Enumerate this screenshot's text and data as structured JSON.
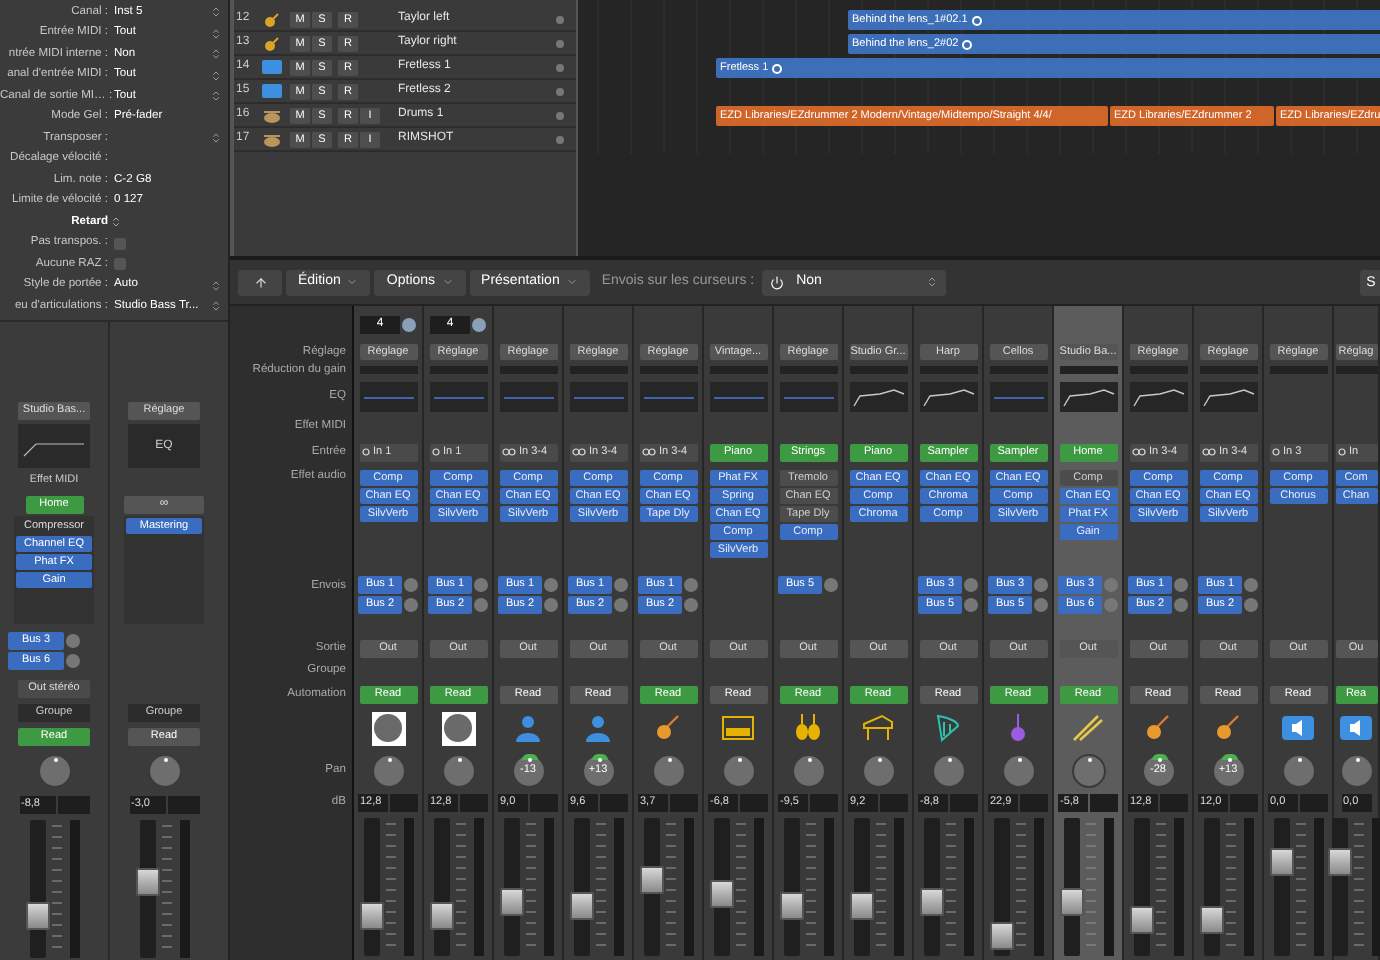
{
  "inspector": {
    "params": [
      {
        "label": "Canal :",
        "value": "Inst 5",
        "kind": "select"
      },
      {
        "label": "Entrée MIDI :",
        "value": "Tout",
        "kind": "select"
      },
      {
        "label": "ntrée MIDI interne :",
        "value": "Non",
        "kind": "select"
      },
      {
        "label": "anal d'entrée MIDI :",
        "value": "Tout",
        "kind": "select"
      },
      {
        "label": "Canal de sortie MI… :",
        "value": "Tout",
        "kind": "select"
      },
      {
        "label": "Mode Gel :",
        "value": "Pré-fader",
        "kind": "plain"
      },
      {
        "label": "Transposer :",
        "kind": "select"
      },
      {
        "label": "Décalage vélocité :",
        "kind": "plain"
      },
      {
        "label": "Lim. note :",
        "value": "C-2  G8",
        "kind": "plain"
      },
      {
        "label": "Limite de vélocité :",
        "value": "0  127",
        "kind": "plain"
      },
      {
        "label": "Retard",
        "kind": "stepper"
      },
      {
        "label": "Pas transpos. :",
        "checked": false,
        "kind": "checkbox"
      },
      {
        "label": "Aucune RAZ :",
        "checked": false,
        "kind": "checkbox"
      },
      {
        "label": "Style de portée :",
        "value": "Auto",
        "kind": "select"
      },
      {
        "label": "eu d'articulations :",
        "value": "Studio Bass Tr...",
        "kind": "select"
      }
    ]
  },
  "left_strips": [
    {
      "setting": "Studio Bas...",
      "midi_label": "Effet MIDI",
      "input": {
        "text": "Home",
        "kind": "instrument"
      },
      "inserts": [
        {
          "label": "Compressor",
          "active": false
        },
        {
          "label": "Channel EQ",
          "active": true
        },
        {
          "label": "Phat FX",
          "active": true
        },
        {
          "label": "Gain",
          "active": true
        }
      ],
      "sends": [
        {
          "label": "Bus 3"
        },
        {
          "label": "Bus 6"
        }
      ],
      "output": "Out stéréo",
      "group": "Groupe",
      "automation": {
        "label": "Read",
        "active": true
      },
      "db": "-8,8",
      "level": 0.25
    },
    {
      "setting": "Réglage",
      "eq_text": "EQ",
      "input": {
        "text": "∞",
        "kind": "link"
      },
      "inserts": [
        {
          "label": "Mastering",
          "active": true
        }
      ],
      "group": "Groupe",
      "automation": {
        "label": "Read",
        "active": false
      },
      "db": "-3,0",
      "level": 0.55
    }
  ],
  "tracks": [
    {
      "number": "12",
      "kind": "guitar",
      "buttons": [
        "M",
        "S",
        "R"
      ],
      "name": "Taylor left",
      "regions": [
        {
          "label": "Behind the lens_1#02.1",
          "kind": "audio",
          "looped": true
        }
      ]
    },
    {
      "number": "13",
      "kind": "guitar",
      "buttons": [
        "M",
        "S",
        "R"
      ],
      "name": "Taylor right",
      "regions": [
        {
          "label": "Behind the lens_2#02",
          "kind": "audio",
          "looped": true
        }
      ]
    },
    {
      "number": "14",
      "kind": "software",
      "buttons": [
        "M",
        "S",
        "R"
      ],
      "name": "Fretless 1",
      "regions": [
        {
          "label": "Fretless 1",
          "kind": "audio",
          "looped": true
        }
      ]
    },
    {
      "number": "15",
      "kind": "software",
      "buttons": [
        "M",
        "S",
        "R"
      ],
      "name": "Fretless 2"
    },
    {
      "number": "16",
      "kind": "drums",
      "buttons": [
        "M",
        "S",
        "R",
        "I"
      ],
      "name": "Drums 1",
      "regions": [
        {
          "label": "EZD Libraries/EZdrummer 2 Modern/Vintage/Midtempo/Straight 4/4/",
          "kind": "drummer",
          "looped": false
        },
        {
          "label": "EZD Libraries/EZdrummer 2",
          "kind": "drummer",
          "looped": false
        },
        {
          "label": "EZD Libraries/EZdru",
          "kind": "drummer",
          "looped": false
        }
      ]
    },
    {
      "number": "17",
      "kind": "drums",
      "buttons": [
        "M",
        "S",
        "R",
        "I"
      ],
      "name": "RIMSHOT"
    }
  ],
  "mixer": {
    "toolbar": {
      "menus": [
        "Édition",
        "Options",
        "Présentation"
      ],
      "sends_label": "Envois sur les curseurs :",
      "sends_value": "Non",
      "right_button": "S"
    },
    "row_labels": [
      "Réglage",
      "Réduction du gain",
      "EQ",
      "Effet MIDI",
      "Entrée",
      "Effet audio",
      "Envois",
      "Sortie",
      "Groupe",
      "Automation",
      "Pan",
      "dB"
    ],
    "strips": [
      {
        "kind": "avatar",
        "field": "4",
        "setting": "Réglage",
        "eq": {
          "kind": "flat"
        },
        "input": {
          "text": "In 1",
          "kind": "mono"
        },
        "inserts": [
          {
            "label": "Comp",
            "active": true
          },
          {
            "label": "Chan EQ",
            "active": true
          },
          {
            "label": "SilvVerb",
            "active": true
          }
        ],
        "sends": [
          {
            "label": "Bus 1"
          },
          {
            "label": "Bus 2"
          }
        ],
        "output": "Out",
        "automation": {
          "label": "Read",
          "active": true
        },
        "db": "12,8",
        "level": 0.22,
        "selected": false
      },
      {
        "kind": "avatar",
        "field": "4",
        "setting": "Réglage",
        "eq": {
          "kind": "flat"
        },
        "input": {
          "text": "In 1",
          "kind": "mono"
        },
        "inserts": [
          {
            "label": "Comp",
            "active": true
          },
          {
            "label": "Chan EQ",
            "active": true
          },
          {
            "label": "SilvVerb",
            "active": true
          }
        ],
        "sends": [
          {
            "label": "Bus 1"
          },
          {
            "label": "Bus 2"
          }
        ],
        "output": "Out",
        "automation": {
          "label": "Read",
          "active": true
        },
        "db": "12,8",
        "level": 0.22,
        "selected": false
      },
      {
        "kind": "person",
        "setting": "Réglage",
        "eq": {
          "kind": "flat"
        },
        "input": {
          "text": "In 3-4",
          "kind": "stereo"
        },
        "inserts": [
          {
            "label": "Comp",
            "active": true
          },
          {
            "label": "Chan EQ",
            "active": true
          },
          {
            "label": "SilvVerb",
            "active": true
          }
        ],
        "sends": [
          {
            "label": "Bus 1"
          },
          {
            "label": "Bus 2"
          }
        ],
        "output": "Out",
        "automation": {
          "label": "Read",
          "active": false
        },
        "pan": "-13",
        "db": "9,0",
        "level": 0.35,
        "selected": false
      },
      {
        "kind": "person",
        "setting": "Réglage",
        "eq": {
          "kind": "flat"
        },
        "input": {
          "text": "In 3-4",
          "kind": "stereo"
        },
        "inserts": [
          {
            "label": "Comp",
            "active": true
          },
          {
            "label": "Chan EQ",
            "active": true
          },
          {
            "label": "SilvVerb",
            "active": true
          }
        ],
        "sends": [
          {
            "label": "Bus 1"
          },
          {
            "label": "Bus 2"
          }
        ],
        "output": "Out",
        "automation": {
          "label": "Read",
          "active": false
        },
        "pan": "+13",
        "db": "9,6",
        "level": 0.32,
        "selected": false
      },
      {
        "kind": "guitar",
        "setting": "Réglage",
        "eq": {
          "kind": "flat"
        },
        "input": {
          "text": "In 3-4",
          "kind": "stereo"
        },
        "inserts": [
          {
            "label": "Comp",
            "active": true
          },
          {
            "label": "Chan EQ",
            "active": true
          },
          {
            "label": "Tape Dly",
            "active": true
          }
        ],
        "sends": [
          {
            "label": "Bus 1"
          },
          {
            "label": "Bus 2"
          }
        ],
        "output": "Out",
        "automation": {
          "label": "Read",
          "active": true
        },
        "db": "3,7",
        "level": 0.55,
        "selected": false
      },
      {
        "kind": "keyboard",
        "setting": "Vintage...",
        "eq": {
          "kind": "flat"
        },
        "input": {
          "text": "Piano",
          "kind": "instrument"
        },
        "inserts": [
          {
            "label": "Phat FX",
            "active": true
          },
          {
            "label": "Spring",
            "active": true
          },
          {
            "label": "Chan EQ",
            "active": true
          },
          {
            "label": "Comp",
            "active": true
          },
          {
            "label": "SilvVerb",
            "active": true
          }
        ],
        "output": "Out",
        "automation": {
          "label": "Read",
          "active": false
        },
        "db": "-6,8",
        "level": 0.42,
        "selected": false
      },
      {
        "kind": "violins",
        "setting": "Réglage",
        "eq": {
          "kind": "flat"
        },
        "input": {
          "text": "Strings",
          "kind": "instrument"
        },
        "inserts": [
          {
            "label": "Tremolo",
            "active": false
          },
          {
            "label": "Chan EQ",
            "active": false
          },
          {
            "label": "Tape Dly",
            "active": false
          },
          {
            "label": "Comp",
            "active": true
          }
        ],
        "sends": [
          {
            "label": "Bus 5"
          }
        ],
        "output": "Out",
        "automation": {
          "label": "Read",
          "active": true
        },
        "db": "-9,5",
        "level": 0.32,
        "selected": false
      },
      {
        "kind": "piano",
        "setting": "Studio Gr...",
        "eq": {
          "kind": "curve"
        },
        "input": {
          "text": "Piano",
          "kind": "instrument"
        },
        "inserts": [
          {
            "label": "Chan EQ",
            "active": true
          },
          {
            "label": "Comp",
            "active": true
          },
          {
            "label": "Chroma",
            "active": true
          }
        ],
        "output": "Out",
        "automation": {
          "label": "Read",
          "active": true
        },
        "db": "9,2",
        "level": 0.32,
        "selected": false
      },
      {
        "kind": "harp",
        "setting": "Harp",
        "eq": {
          "kind": "curve"
        },
        "input": {
          "text": "Sampler",
          "kind": "instrument"
        },
        "inserts": [
          {
            "label": "Chan EQ",
            "active": true
          },
          {
            "label": "Chroma",
            "active": true
          },
          {
            "label": "Comp",
            "active": true
          }
        ],
        "sends": [
          {
            "label": "Bus 3"
          },
          {
            "label": "Bus 5"
          }
        ],
        "output": "Out",
        "automation": {
          "label": "Read",
          "active": false
        },
        "db": "-8,8",
        "level": 0.35,
        "selected": false
      },
      {
        "kind": "violin",
        "setting": "Cellos",
        "eq": {
          "kind": "flat"
        },
        "input": {
          "text": "Sampler",
          "kind": "instrument"
        },
        "inserts": [
          {
            "label": "Chan EQ",
            "active": true
          },
          {
            "label": "Comp",
            "active": true
          },
          {
            "label": "SilvVerb",
            "active": true
          }
        ],
        "sends": [
          {
            "label": "Bus 3"
          },
          {
            "label": "Bus 5"
          }
        ],
        "output": "Out",
        "automation": {
          "label": "Read",
          "active": true
        },
        "db": "22,9",
        "level": 0.05,
        "selected": false
      },
      {
        "kind": "drumsticks",
        "setting": "Studio Ba...",
        "eq": {
          "kind": "curve"
        },
        "input": {
          "text": "Home",
          "kind": "instrument"
        },
        "inserts": [
          {
            "label": "Comp",
            "active": false
          },
          {
            "label": "Chan EQ",
            "active": true
          },
          {
            "label": "Phat FX",
            "active": true
          },
          {
            "label": "Gain",
            "active": true
          }
        ],
        "sends": [
          {
            "label": "Bus 3"
          },
          {
            "label": "Bus 6"
          }
        ],
        "output": "Out",
        "automation": {
          "label": "Read",
          "active": true
        },
        "db": "-5,8",
        "level": 0.35,
        "selected": true
      },
      {
        "kind": "guitar",
        "setting": "Réglage",
        "eq": {
          "kind": "curve"
        },
        "input": {
          "text": "In 3-4",
          "kind": "stereo"
        },
        "inserts": [
          {
            "label": "Comp",
            "active": true
          },
          {
            "label": "Chan EQ",
            "active": true
          },
          {
            "label": "SilvVerb",
            "active": true
          }
        ],
        "sends": [
          {
            "label": "Bus 1"
          },
          {
            "label": "Bus 2"
          }
        ],
        "output": "Out",
        "automation": {
          "label": "Read",
          "active": false
        },
        "pan": "-28",
        "db": "12,8",
        "level": 0.2,
        "selected": false
      },
      {
        "kind": "guitar",
        "setting": "Réglage",
        "eq": {
          "kind": "curve"
        },
        "input": {
          "text": "In 3-4",
          "kind": "stereo"
        },
        "inserts": [
          {
            "label": "Comp",
            "active": true
          },
          {
            "label": "Chan EQ",
            "active": true
          },
          {
            "label": "SilvVerb",
            "active": true
          }
        ],
        "sends": [
          {
            "label": "Bus 1"
          },
          {
            "label": "Bus 2"
          }
        ],
        "output": "Out",
        "automation": {
          "label": "Read",
          "active": false
        },
        "pan": "+13",
        "db": "12,0",
        "level": 0.2,
        "selected": false
      },
      {
        "kind": "speaker",
        "setting": "Réglage",
        "eq": {
          "kind": "empty"
        },
        "input": {
          "text": "In 3",
          "kind": "mono"
        },
        "inserts": [
          {
            "label": "Comp",
            "active": true
          },
          {
            "label": "Chorus",
            "active": true
          }
        ],
        "output": "Out",
        "automation": {
          "label": "Read",
          "active": false
        },
        "db": "0,0",
        "level": 0.7,
        "selected": false
      },
      {
        "kind": "speaker",
        "setting": "Réglag",
        "eq": {
          "kind": "empty"
        },
        "input": {
          "text": "In",
          "kind": "mono"
        },
        "inserts": [
          {
            "label": "Com",
            "active": true
          },
          {
            "label": "Chan",
            "active": true
          }
        ],
        "output": "Ou",
        "automation": {
          "label": "Rea",
          "active": true
        },
        "db": "0,0",
        "level": 0.7,
        "selected": false
      }
    ]
  }
}
